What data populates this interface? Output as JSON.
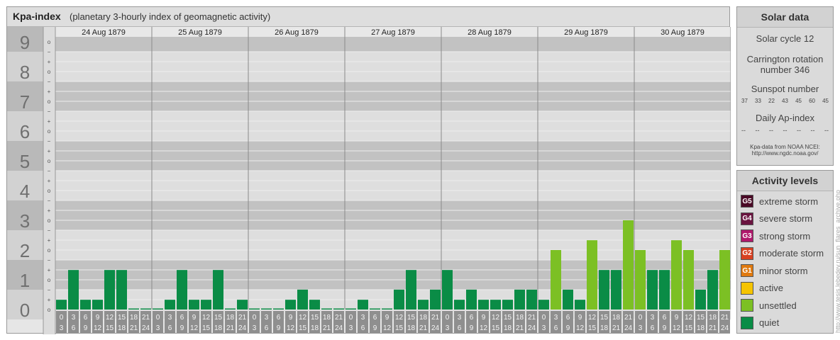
{
  "header": {
    "title": "Kpa-index",
    "subtitle": "(planetary 3-hourly index of geomagnetic activity)"
  },
  "chart_data": {
    "type": "bar",
    "title": "Kpa-index",
    "subtitle": "(planetary 3-hourly index of geomagnetic activity)",
    "ylim": [
      0,
      9
    ],
    "y_ticks": [
      "0",
      "1",
      "2",
      "3",
      "4",
      "5",
      "6",
      "7",
      "8",
      "9"
    ],
    "minor_ticks": [
      "o",
      "+",
      "−"
    ],
    "days": [
      "24 Aug 1879",
      "25 Aug 1879",
      "26 Aug 1879",
      "27 Aug 1879",
      "28 Aug 1879",
      "29 Aug 1879",
      "30 Aug 1879"
    ],
    "slot_labels_top": [
      "0",
      "3",
      "6",
      "9",
      "12",
      "15",
      "18",
      "21"
    ],
    "slot_labels_bottom": [
      "3",
      "6",
      "9",
      "12",
      "15",
      "18",
      "21",
      "24"
    ],
    "series": [
      {
        "name": "quiet/unsettled",
        "values": [
          0.33,
          1.33,
          0.33,
          0.33,
          1.33,
          1.33,
          0,
          0,
          0,
          0.33,
          1.33,
          0.33,
          0.33,
          1.33,
          0,
          0.33,
          0,
          0,
          0,
          0.33,
          0.67,
          0.33,
          0,
          0,
          0,
          0.33,
          0,
          0,
          0.67,
          1.33,
          0.33,
          0.67,
          1.33,
          0.33,
          0.67,
          0.33,
          0.33,
          0.33,
          0.67,
          0.67,
          0.33,
          2.0,
          0.67,
          0.33,
          2.33,
          1.33,
          1.33,
          3.0,
          2.0,
          1.33,
          1.33,
          2.33,
          2.0,
          0.67,
          1.33,
          2.0
        ]
      }
    ],
    "levels": [
      {
        "max": 1.67,
        "color": "#0a8c46"
      },
      {
        "max": 3.67,
        "color": "#7cc024"
      },
      {
        "max": 4.67,
        "color": "#f5c400"
      },
      {
        "max": 5.67,
        "color": "#e07a10"
      },
      {
        "max": 6.67,
        "color": "#d84020"
      },
      {
        "max": 7.67,
        "color": "#b0186c"
      },
      {
        "max": 8.67,
        "color": "#6a1440"
      },
      {
        "max": 9.0,
        "color": "#4a0a26"
      }
    ]
  },
  "solar": {
    "heading": "Solar data",
    "cycle": "Solar cycle 12",
    "carrington_line1": "Carrington rotation",
    "carrington_line2": "number 346",
    "sunspot_label": "Sunspot number",
    "sunspots": [
      "37",
      "33",
      "22",
      "43",
      "45",
      "60",
      "45"
    ],
    "ap_label": "Daily Ap-index",
    "ap_values": [
      "--",
      "--",
      "--",
      "--",
      "--",
      "--",
      "--"
    ],
    "source_line1": "Kpa-data from NOAA NCEI:",
    "source_line2": "http://www.ngdc.noaa.gov/"
  },
  "activity": {
    "heading": "Activity levels",
    "items": [
      {
        "code": "G5",
        "label": "extreme storm",
        "color": "#4a0a26"
      },
      {
        "code": "G4",
        "label": "severe storm",
        "color": "#6a1440"
      },
      {
        "code": "G3",
        "label": "strong storm",
        "color": "#b0186c"
      },
      {
        "code": "G2",
        "label": "moderate storm",
        "color": "#d84020"
      },
      {
        "code": "G1",
        "label": "minor storm",
        "color": "#e07a10"
      },
      {
        "code": "",
        "label": "active",
        "color": "#f5c400"
      },
      {
        "code": "",
        "label": "unsettled",
        "color": "#7cc024"
      },
      {
        "code": "",
        "label": "quiet",
        "color": "#0a8c46"
      }
    ]
  },
  "credit": "http://www.tesis.lebedev.ru/sun_flares_archive.php"
}
